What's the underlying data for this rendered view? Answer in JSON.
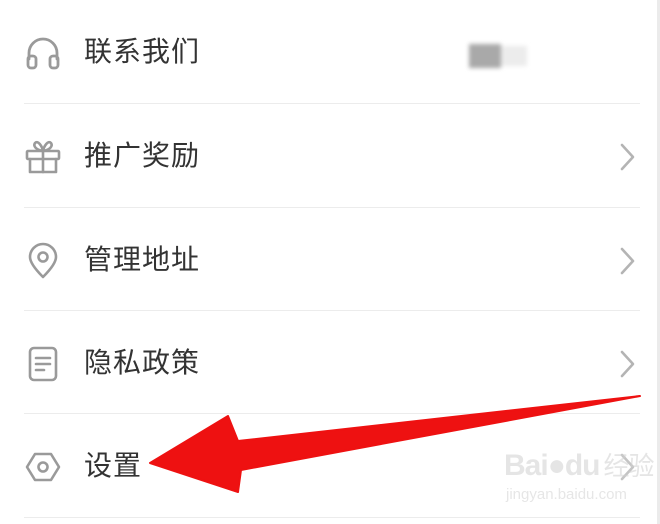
{
  "menu": {
    "items": [
      {
        "label": "联系我们",
        "icon": "headset-icon",
        "trailing": "blurred-value"
      },
      {
        "label": "推广奖励",
        "icon": "gift-icon",
        "trailing": "chevron-right-icon"
      },
      {
        "label": "管理地址",
        "icon": "location-pin-icon",
        "trailing": "chevron-right-icon"
      },
      {
        "label": "隐私政策",
        "icon": "document-icon",
        "trailing": "chevron-right-icon"
      },
      {
        "label": "设置",
        "icon": "hexagon-settings-icon",
        "trailing": "chevron-right-icon"
      }
    ]
  },
  "annotation": {
    "color": "#ee1111"
  },
  "watermark": {
    "brand": "Bai",
    "brand_suffix": "du",
    "brand_cn": "经验",
    "url": "jingyan.baidu.com"
  },
  "colors": {
    "label": "#333333",
    "icon": "#9a9a9a",
    "divider": "#ececec",
    "chevron": "#b4b4b4"
  }
}
